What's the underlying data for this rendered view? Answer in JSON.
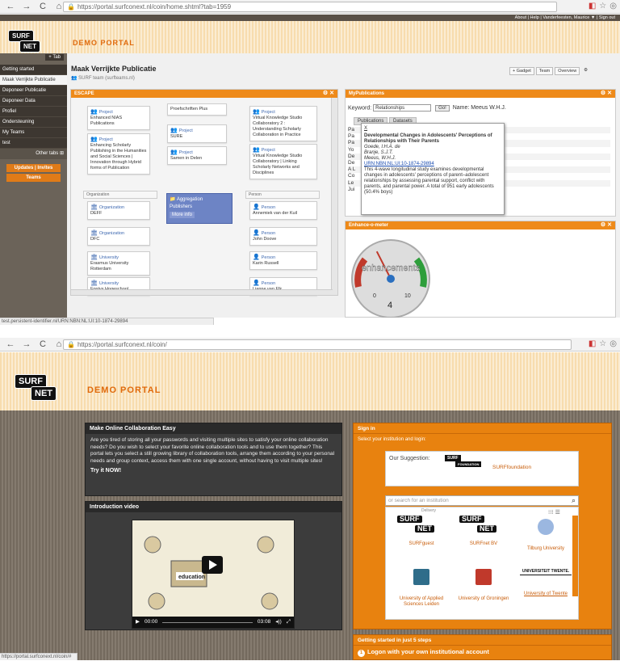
{
  "top": {
    "browser": {
      "url": "https://portal.surfconext.nl/coin/home.shtml?tab=1959"
    },
    "header": {
      "logo_top": "SURF",
      "logo_bottom": "NET",
      "portal_title": "DEMO PORTAL",
      "links": [
        "About",
        "Help",
        "Vanderfeesten, Maurice ▼",
        "Sign out"
      ]
    },
    "sidebar": {
      "tab_button": "+ Tab",
      "items": [
        "Getting started",
        "Maak Verrijkte Publicatie",
        "Deponeer Publicatie",
        "Deponeer Data",
        "Profiel",
        "Ondersteuning",
        "My Teams",
        "test"
      ],
      "other_tabs": "Other tabs",
      "updates_btn": "Updates | Invites",
      "teams_btn": "Teams"
    },
    "page": {
      "title": "Maak Verrijkte Publicatie",
      "subtitle": "SURF team (surfteams.nl)",
      "actions": [
        "+ Gadget",
        "Team",
        "Overview"
      ]
    },
    "escape": {
      "title": "ESCAPE",
      "cards": [
        {
          "type": "Project",
          "name": "Enhanced NIAS Publications"
        },
        {
          "type": "Project",
          "name": "Enhancing Scholarly Publishing in the Humanities and Social Sciences | Innovation through Hybrid forms of Publication"
        },
        {
          "type": "",
          "name": "Proefschriften Plus"
        },
        {
          "type": "Project",
          "name": "SURE"
        },
        {
          "type": "Project",
          "name": "Samen in Delen"
        },
        {
          "type": "Project",
          "name": "Virtual Knowledge Studio Collaboratory 2 : Understanding Scholarly Collaboration in Practice"
        },
        {
          "type": "Project",
          "name": "Virtual Knowledge Studio Collaboratory | Linking Scholarly Networks and Disciplines"
        },
        {
          "type": "Organization",
          "name": "DEFF"
        },
        {
          "type": "Organization",
          "name": "DFC"
        },
        {
          "type": "University",
          "name": "Erasmus University Rotterdam"
        },
        {
          "type": "University",
          "name": "Fontys Hogeschool"
        },
        {
          "type": "Person",
          "name": "Annemiek van der Kuil"
        },
        {
          "type": "Person",
          "name": "John Doove"
        },
        {
          "type": "Person",
          "name": "Karin Russell"
        },
        {
          "type": "Person",
          "name": "Lianne van Elk"
        }
      ],
      "groups": [
        "Organization",
        "Person"
      ],
      "aggregation": {
        "type": "Aggregation",
        "name": "Publishers",
        "more": "More info"
      }
    },
    "mypubs": {
      "title": "MyPublications",
      "keyword_label": "Keyword:",
      "keyword_value": "Relationships",
      "go": "Go!",
      "name_label": "Name: Meeus W.H.J.",
      "tabs": [
        "Publications",
        "Datasets"
      ],
      "rows": [
        "Pa",
        "Pa",
        "Pa",
        "Yo",
        "De",
        "De",
        "A L",
        "Co",
        "Le",
        "Jui"
      ],
      "popup": {
        "close": "X",
        "title": "Developmental Changes in Adolescents' Perceptions of Relationships with Their Parents",
        "authors": [
          "Goede, I.H.A. de",
          "Branje, S.J.T.",
          "Meeus, W.H.J."
        ],
        "link": "URN:NBN:NL:UI:10-1874-29894",
        "abstract": "This 4-wave longitudinal study examines developmental changes in adolescents' perceptions of parent–adolescent relationships by assessing parental support, conflict with parents, and parental power. A total of 951 early adolescents (50.4% boys)"
      }
    },
    "gauge": {
      "title": "Enhance-o-meter",
      "label": "enhancements",
      "min": "0",
      "max": "10",
      "value": "4",
      "value_num": 4
    },
    "status": "test.persistent-identifier.nl/URN:NBN:NL:UI:10-1874-29894"
  },
  "bottom": {
    "browser": {
      "url": "https://portal.surfconext.nl/coin/"
    },
    "header": {
      "logo_top": "SURF",
      "logo_bottom": "NET",
      "portal_title": "DEMO PORTAL"
    },
    "intro": {
      "title": "Make Online Collaboration Easy",
      "text": "Are you tired of storing all your passwords and visiting multiple sites to satisfy your online collaboration needs? Do you wish to select your favorite online collaboration tools and to use them together? This portal lets you select a still growing library of collaboration tools, arrange them according to your personal needs and group context, access them with one single account, without having to visit multiple sites!",
      "cta": "Try it NOW!"
    },
    "video": {
      "title": "Introduction video",
      "caption": "education",
      "time_current": "00:00",
      "time_total": "03:08"
    },
    "signin": {
      "title": "Sign in",
      "subtitle": "Select your institution and login:",
      "suggestion_label": "Our Suggestion:",
      "suggestion_name": "SURFfoundation",
      "foundation_badge": "FOUNDATION",
      "search_placeholder": "or search for an institution",
      "scroll_label": "Delivery",
      "institutions": [
        {
          "name": "SURFguest"
        },
        {
          "name": "SURFnet BV"
        },
        {
          "name": "Tilburg University"
        },
        {
          "name": "University of Applied Sciences Leiden"
        },
        {
          "name": "University of Groningen"
        },
        {
          "name": "University of Twente"
        }
      ],
      "twente_logo": "UNIVERSITEIT TWENTE."
    },
    "steps": {
      "title": "Getting started in just 5 steps",
      "step1": "Logon with your own institutional account"
    },
    "status": "https://portal.surfconext.nl/coin/#"
  }
}
